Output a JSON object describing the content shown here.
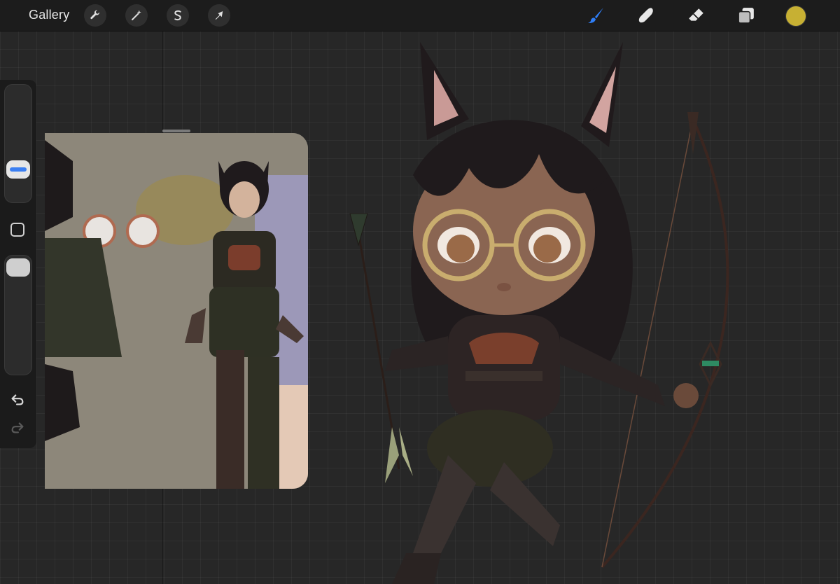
{
  "topbar": {
    "gallery_label": "Gallery",
    "left_tools": [
      {
        "name": "actions",
        "icon": "wrench-icon"
      },
      {
        "name": "adjustments",
        "icon": "magic-wand-icon"
      },
      {
        "name": "selection",
        "icon": "selection-s-icon"
      },
      {
        "name": "transform",
        "icon": "arrow-cursor-icon"
      }
    ],
    "right_tools": [
      {
        "name": "brush",
        "icon": "brush-icon",
        "active": true,
        "color": "#2f7ef6"
      },
      {
        "name": "smudge",
        "icon": "smudge-finger-icon"
      },
      {
        "name": "eraser",
        "icon": "eraser-icon"
      },
      {
        "name": "layers",
        "icon": "layers-icon"
      }
    ],
    "current_color": "#c7b033"
  },
  "sidebar": {
    "brush_size_icon": "size-slider",
    "modify_icon": "square-icon",
    "brush_opacity_icon": "opacity-slider",
    "undo_icon": "undo-arrow-icon",
    "redo_icon": "redo-arrow-icon"
  },
  "reference_window": {
    "content": "reference-artwork-image"
  },
  "canvas": {
    "content": "chibi-catgirl-archer-illustration"
  }
}
